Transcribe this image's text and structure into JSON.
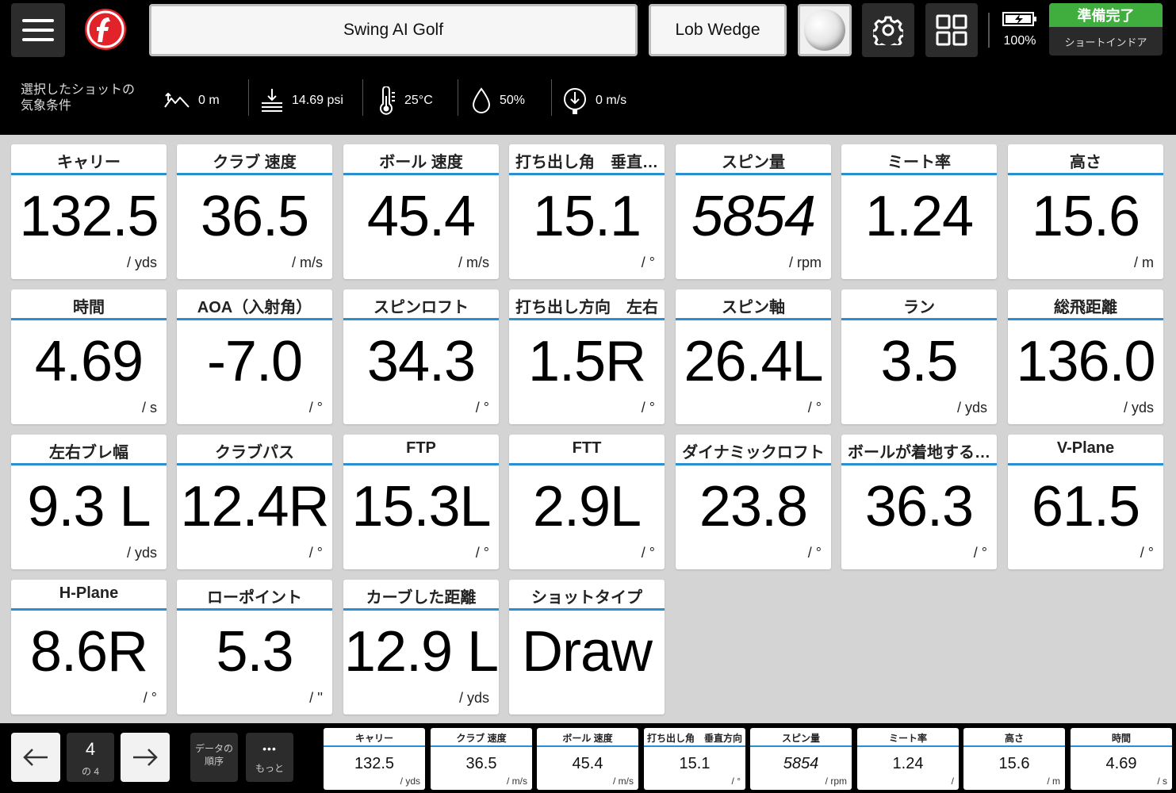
{
  "header": {
    "title": "Swing AI Golf",
    "club": "Lob Wedge",
    "battery": "100%",
    "status_top": "準備完了",
    "status_bottom": "ショートインドア",
    "accent_color": "#2a8fd0",
    "status_color": "#3fae3f"
  },
  "weather": {
    "label_line1": "選択したショットの",
    "label_line2": "気象条件",
    "altitude": "0 m",
    "pressure": "14.69 psi",
    "temperature": "25°C",
    "humidity": "50%",
    "wind": "0 m/s"
  },
  "tiles": [
    {
      "title": "キャリー",
      "value": "132.5",
      "unit": "/ yds"
    },
    {
      "title": "クラブ 速度",
      "value": "36.5",
      "unit": "/ m/s"
    },
    {
      "title": "ボール 速度",
      "value": "45.4",
      "unit": "/ m/s"
    },
    {
      "title": "打ち出し角　垂直…",
      "value": "15.1",
      "unit": "/ °"
    },
    {
      "title": "スピン量",
      "value": "5854",
      "unit": "/ rpm",
      "italic": true
    },
    {
      "title": "ミート率",
      "value": "1.24",
      "unit": ""
    },
    {
      "title": "高さ",
      "value": "15.6",
      "unit": "/ m"
    },
    {
      "title": "時間",
      "value": "4.69",
      "unit": "/ s"
    },
    {
      "title": "AOA（入射角）",
      "value": "-7.0",
      "unit": "/ °"
    },
    {
      "title": "スピンロフト",
      "value": "34.3",
      "unit": "/ °"
    },
    {
      "title": "打ち出し方向　左右",
      "value": "1.5R",
      "unit": "/ °"
    },
    {
      "title": "スピン軸",
      "value": "26.4L",
      "unit": "/ °"
    },
    {
      "title": "ラン",
      "value": "3.5",
      "unit": "/ yds"
    },
    {
      "title": "総飛距離",
      "value": "136.0",
      "unit": "/ yds"
    },
    {
      "title": "左右ブレ幅",
      "value": "9.3 L",
      "unit": "/ yds"
    },
    {
      "title": "クラブパス",
      "value": "12.4R",
      "unit": "/ °"
    },
    {
      "title": "FTP",
      "value": "15.3L",
      "unit": "/ °"
    },
    {
      "title": "FTT",
      "value": "2.9L",
      "unit": "/ °"
    },
    {
      "title": "ダイナミックロフト",
      "value": "23.8",
      "unit": "/ °"
    },
    {
      "title": "ボールが着地する…",
      "value": "36.3",
      "unit": "/ °"
    },
    {
      "title": "V-Plane",
      "value": "61.5",
      "unit": "/ °"
    },
    {
      "title": "H-Plane",
      "value": "8.6R",
      "unit": "/ °"
    },
    {
      "title": "ローポイント",
      "value": "5.3",
      "unit": "/ ''"
    },
    {
      "title": "カーブした距離",
      "value": "12.9 L",
      "unit": "/ yds"
    },
    {
      "title": "ショットタイプ",
      "value": "Draw",
      "unit": ""
    }
  ],
  "footer": {
    "page_current": "4",
    "page_of": "の 4",
    "data_order_line1": "データの",
    "data_order_line2": "順序",
    "more_label": "もっと",
    "more_dots": "•••",
    "minis": [
      {
        "title": "キャリー",
        "value": "132.5",
        "unit": "/ yds"
      },
      {
        "title": "クラブ 速度",
        "value": "36.5",
        "unit": "/ m/s"
      },
      {
        "title": "ボール 速度",
        "value": "45.4",
        "unit": "/ m/s"
      },
      {
        "title": "打ち出し角　垂直方向",
        "value": "15.1",
        "unit": "/ °"
      },
      {
        "title": "スピン量",
        "value": "5854",
        "unit": "/ rpm",
        "italic": true
      },
      {
        "title": "ミート率",
        "value": "1.24",
        "unit": "/"
      },
      {
        "title": "高さ",
        "value": "15.6",
        "unit": "/ m"
      },
      {
        "title": "時間",
        "value": "4.69",
        "unit": "/ s"
      }
    ]
  }
}
